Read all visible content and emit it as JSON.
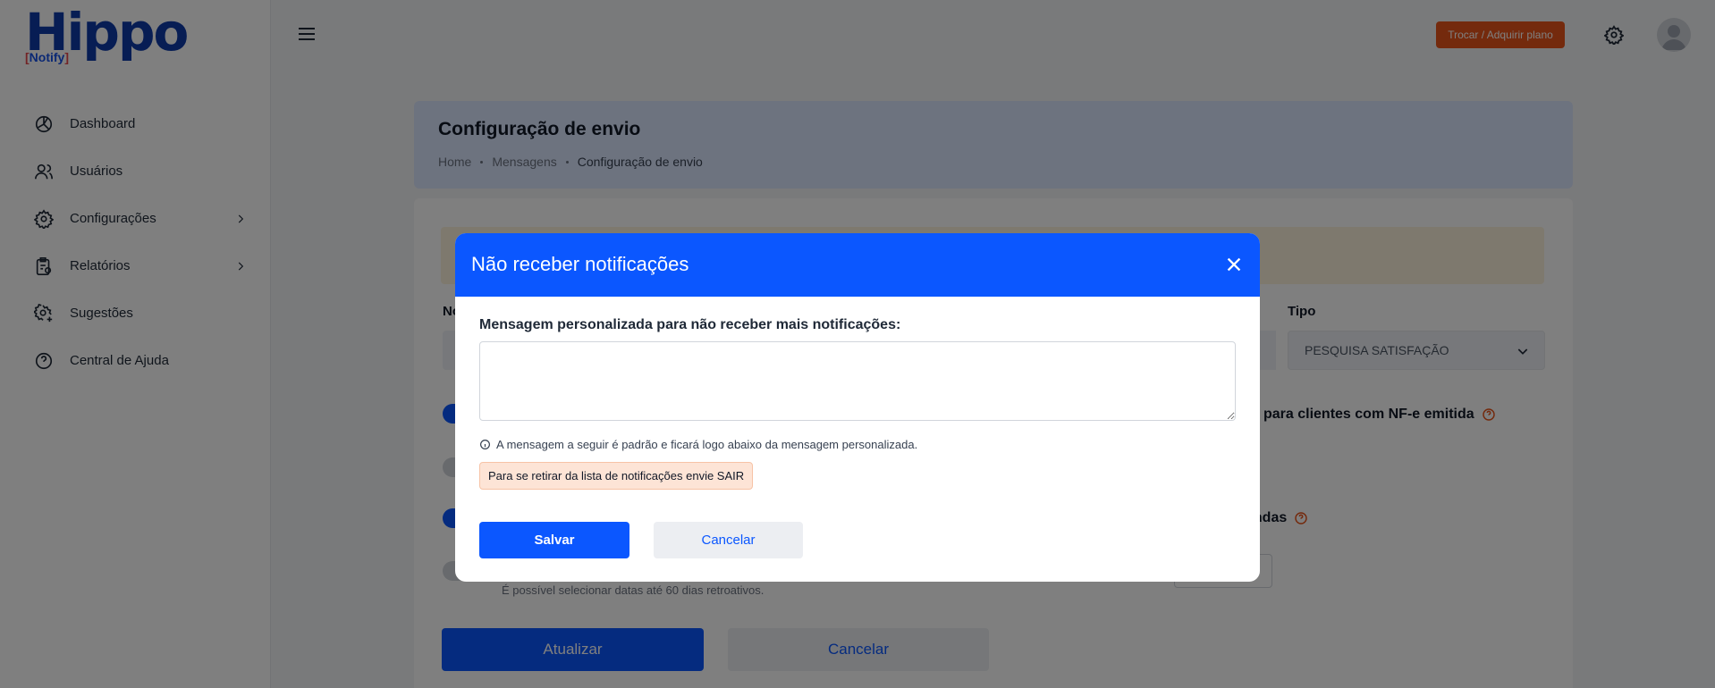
{
  "brand": {
    "name": "Hippo",
    "sub": "Notify"
  },
  "sidebar": {
    "items": [
      {
        "label": "Dashboard",
        "icon": "dashboard-icon",
        "has_submenu": false
      },
      {
        "label": "Usuários",
        "icon": "users-icon",
        "has_submenu": false
      },
      {
        "label": "Configurações",
        "icon": "gear-icon",
        "has_submenu": true
      },
      {
        "label": "Relatórios",
        "icon": "report-icon",
        "has_submenu": true
      },
      {
        "label": "Sugestões",
        "icon": "suggestion-gear-icon",
        "has_submenu": false
      },
      {
        "label": "Central de Ajuda",
        "icon": "help-circle-icon",
        "has_submenu": false
      }
    ]
  },
  "header": {
    "plan_button": "Trocar / Adquirir plano"
  },
  "page": {
    "title": "Configuração de envio",
    "breadcrumb": [
      "Home",
      "Mensagens",
      "Configuração de envio"
    ]
  },
  "form": {
    "name_label_partial": "No",
    "type_label": "Tipo",
    "type_value": "PESQUISA SATISFAÇÃO",
    "option1_partial": "para clientes com NF-e emitida",
    "option2_partial": "endas",
    "date_hint": "É possível selecionar datas até 60 dias retroativos.",
    "update_button": "Atualizar",
    "cancel_button": "Cancelar"
  },
  "modal": {
    "title": "Não receber notificações",
    "label": "Mensagem personalizada para não receber mais notificações:",
    "textarea_value": "",
    "info_text": "A mensagem a seguir é padrão e ficará logo abaixo da mensagem personalizada.",
    "default_message": "Para se retirar da lista de notificações envie SAIR",
    "save_button": "Salvar",
    "cancel_button": "Cancelar"
  },
  "colors": {
    "primary": "#0b57ff",
    "accent": "#e8541a",
    "warning_bg": "#fdf3dc"
  }
}
